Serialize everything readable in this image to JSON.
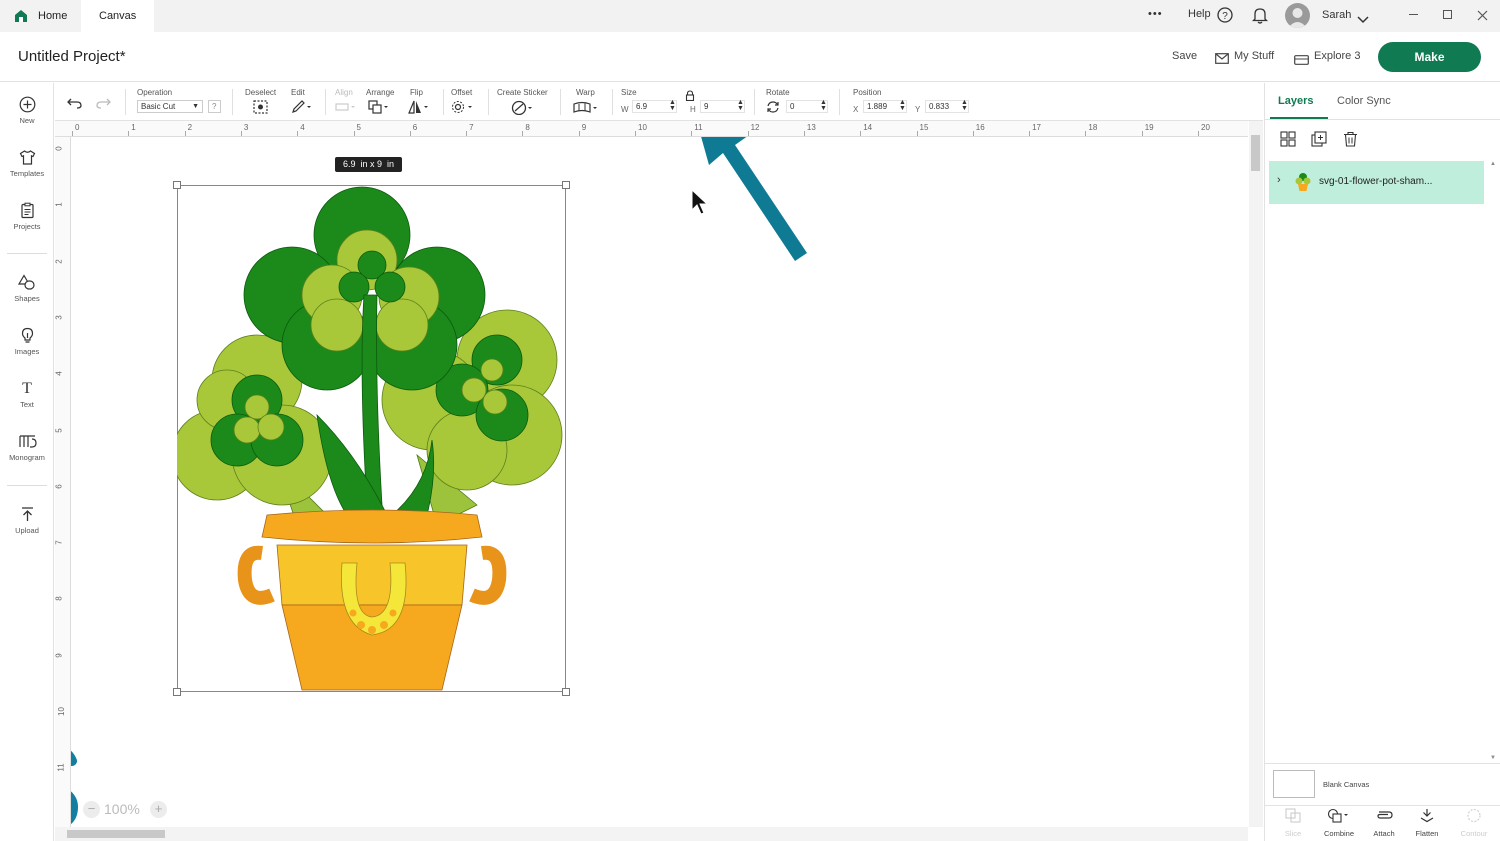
{
  "tabs": {
    "home": "Home",
    "canvas": "Canvas"
  },
  "topbar": {
    "more": "•••",
    "help": "Help",
    "user": "Sarah"
  },
  "header": {
    "title": "Untitled Project*",
    "save": "Save",
    "my_stuff": "My Stuff",
    "machine": "Explore 3",
    "make": "Make"
  },
  "toolbar": {
    "operation_label": "Operation",
    "operation_value": "Basic Cut",
    "deselect": "Deselect",
    "edit": "Edit",
    "align": "Align",
    "arrange": "Arrange",
    "flip": "Flip",
    "offset": "Offset",
    "create_sticker": "Create Sticker",
    "warp": "Warp",
    "size": "Size",
    "w_label": "W",
    "w_value": "6.9",
    "h_label": "H",
    "h_value": "9",
    "rotate": "Rotate",
    "rotate_value": "0",
    "position": "Position",
    "x_label": "X",
    "x_value": "1.889",
    "y_label": "Y",
    "y_value": "0.833"
  },
  "sidebar": {
    "items": [
      {
        "label": "New",
        "icon": "plus-circle-icon"
      },
      {
        "label": "Templates",
        "icon": "tshirt-icon"
      },
      {
        "label": "Projects",
        "icon": "clipboard-icon"
      },
      {
        "label": "Shapes",
        "icon": "shapes-icon"
      },
      {
        "label": "Images",
        "icon": "lightbulb-icon"
      },
      {
        "label": "Text",
        "icon": "text-icon"
      },
      {
        "label": "Monogram",
        "icon": "monogram-icon"
      },
      {
        "label": "Upload",
        "icon": "upload-icon"
      }
    ]
  },
  "rulers": {
    "top": [
      "0",
      "1",
      "2",
      "3",
      "4",
      "5",
      "6",
      "7",
      "8",
      "9",
      "10",
      "11",
      "12",
      "13",
      "14",
      "15",
      "16",
      "17",
      "18",
      "19",
      "20"
    ],
    "left": [
      "0",
      "1",
      "2",
      "3",
      "4",
      "5",
      "6",
      "7",
      "8",
      "9",
      "10",
      "11"
    ]
  },
  "canvas": {
    "size_tooltip": "6.9  in x 9  in",
    "zoom": "100%"
  },
  "panel": {
    "tab_layers": "Layers",
    "tab_color_sync": "Color Sync",
    "layer_name": "svg-01-flower-pot-sham...",
    "blank_canvas": "Blank Canvas",
    "actions": [
      "Slice",
      "Combine",
      "Attach",
      "Flatten",
      "Contour"
    ]
  },
  "colors": {
    "brand": "#107a52",
    "arrow": "#0e7a93",
    "layer_selected": "#bfeedd"
  }
}
